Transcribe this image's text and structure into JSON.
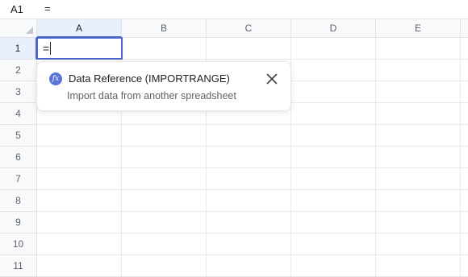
{
  "formula_bar": {
    "name_box": "A1",
    "formula": "="
  },
  "columns": [
    "A",
    "B",
    "C",
    "D",
    "E"
  ],
  "rows": [
    "1",
    "2",
    "3",
    "4",
    "5",
    "6",
    "7",
    "8",
    "9",
    "10",
    "11"
  ],
  "active_cell": {
    "ref": "A1",
    "value": "="
  },
  "suggestion": {
    "icon": "fx-icon",
    "title": "Data Reference (IMPORTRANGE)",
    "description": "Import data from another spreadsheet",
    "close_icon": "close-icon"
  },
  "colors": {
    "accent": "#4a66c9",
    "fx_badge": "#5b73d8",
    "header_bg": "#f8f9fa",
    "grid": "#e8eaed"
  }
}
